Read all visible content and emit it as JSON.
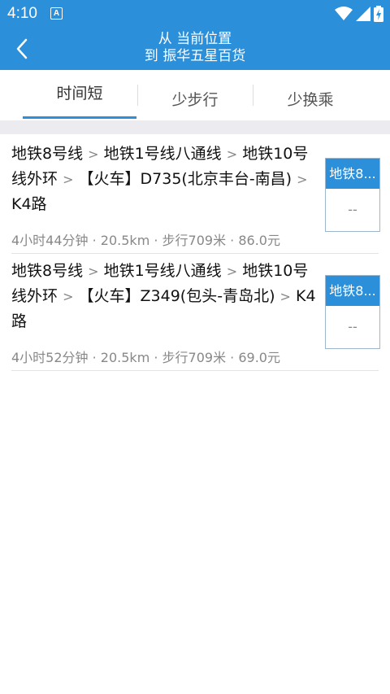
{
  "status_bar": {
    "time": "4:10",
    "notification_badge": "A"
  },
  "header": {
    "title_line1": "从 当前位置",
    "title_line2": "到 振华五星百货",
    "accent_color": "#2b8fd9"
  },
  "tabs": [
    {
      "label": "时间短",
      "selected": true
    },
    {
      "label": "少步行",
      "selected": false
    },
    {
      "label": "少换乘",
      "selected": false
    }
  ],
  "routes": [
    {
      "segments": [
        "地铁8号线",
        "地铁1号线八通线",
        "地铁10号线外环",
        "【火车】D735(北京丰台-南昌)",
        "K4路"
      ],
      "meta": "4小时44分钟 · 20.5km · 步行709米 · 86.0元",
      "badge_top": "地铁8...",
      "badge_bottom": "--"
    },
    {
      "segments": [
        "地铁8号线",
        "地铁1号线八通线",
        "地铁10号线外环",
        "【火车】Z349(包头-青岛北)",
        "K4路"
      ],
      "meta": "4小时52分钟 · 20.5km · 步行709米 · 69.0元",
      "badge_top": "地铁8...",
      "badge_bottom": "--"
    }
  ],
  "separator_glyph": ">"
}
